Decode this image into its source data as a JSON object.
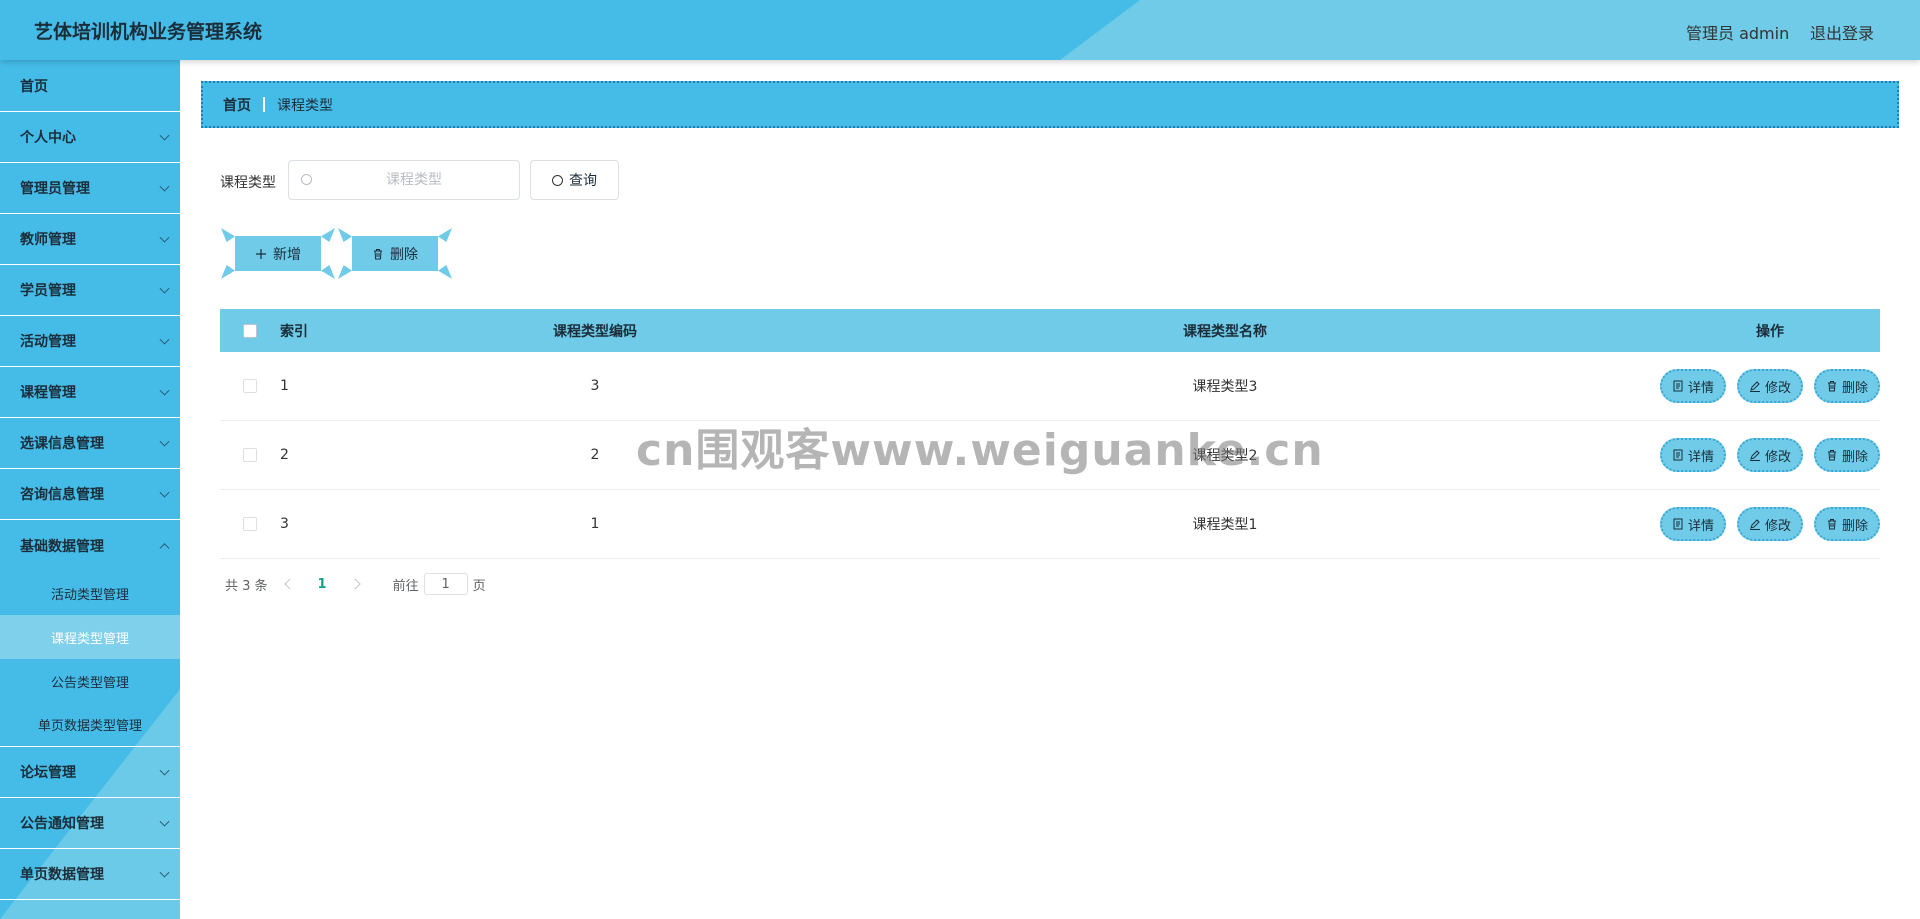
{
  "header": {
    "title": "艺体培训机构业务管理系统",
    "user": "管理员 admin",
    "logout": "退出登录"
  },
  "sidebar": {
    "items": [
      {
        "label": "首页"
      },
      {
        "label": "个人中心"
      },
      {
        "label": "管理员管理"
      },
      {
        "label": "教师管理"
      },
      {
        "label": "学员管理"
      },
      {
        "label": "活动管理"
      },
      {
        "label": "课程管理"
      },
      {
        "label": "选课信息管理"
      },
      {
        "label": "咨询信息管理"
      },
      {
        "label": "基础数据管理"
      },
      {
        "label": "论坛管理"
      },
      {
        "label": "公告通知管理"
      },
      {
        "label": "单页数据管理"
      }
    ],
    "subitems": [
      {
        "label": "活动类型管理"
      },
      {
        "label": "课程类型管理"
      },
      {
        "label": "公告类型管理"
      },
      {
        "label": "单页数据类型管理"
      }
    ]
  },
  "breadcrumb": {
    "home": "首页",
    "current": "课程类型"
  },
  "search": {
    "label": "课程类型",
    "placeholder": "课程类型",
    "button": "查询"
  },
  "actions": {
    "add": "新增",
    "delete": "删除"
  },
  "table": {
    "headers": {
      "index": "索引",
      "code": "课程类型编码",
      "name": "课程类型名称",
      "ops": "操作"
    },
    "rows": [
      {
        "index": "1",
        "code": "3",
        "name": "课程类型3"
      },
      {
        "index": "2",
        "code": "2",
        "name": "课程类型2"
      },
      {
        "index": "3",
        "code": "1",
        "name": "课程类型1"
      }
    ],
    "ops": {
      "detail": "详情",
      "edit": "修改",
      "delete": "删除"
    }
  },
  "pager": {
    "total": "共 3 条",
    "current_page": "1",
    "goto_prefix": "前往",
    "goto_value": "1",
    "goto_suffix": "页"
  },
  "watermark": "cn围观客www.weiguanke.cn",
  "colors": {
    "primary": "#45bce8",
    "light": "#6fcbe7",
    "active_sub": "#7fd0eb",
    "page_active": "#16a085"
  }
}
